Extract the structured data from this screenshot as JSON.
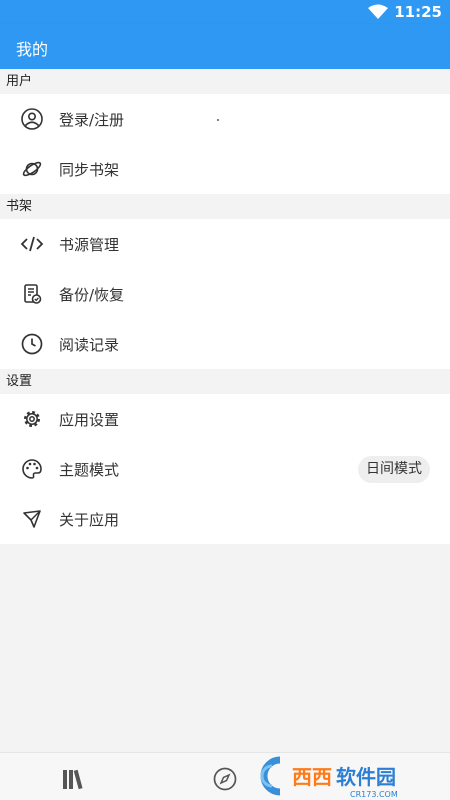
{
  "status_bar": {
    "time": "11:25"
  },
  "app_bar": {
    "title": "我的"
  },
  "sections": [
    {
      "header": "用户",
      "items": [
        {
          "label": "登录/注册"
        },
        {
          "label": "同步书架"
        }
      ]
    },
    {
      "header": "书架",
      "items": [
        {
          "label": "书源管理"
        },
        {
          "label": "备份/恢复"
        },
        {
          "label": "阅读记录"
        }
      ]
    },
    {
      "header": "设置",
      "items": [
        {
          "label": "应用设置"
        },
        {
          "label": "主题模式",
          "value": "日间模式"
        },
        {
          "label": "关于应用"
        }
      ]
    }
  ],
  "colors": {
    "accent": "#2f98f3",
    "background": "#f3f3f3",
    "text": "#333333"
  },
  "icons": {
    "login": "account-circle-icon",
    "sync": "planet-icon",
    "source": "code-icon",
    "backup": "backup-document-icon",
    "history": "clock-icon",
    "settings": "gear-icon",
    "theme": "palette-icon",
    "about": "send-icon"
  },
  "watermark": {
    "brand": "西西软件园",
    "site": "CR173.COM"
  }
}
